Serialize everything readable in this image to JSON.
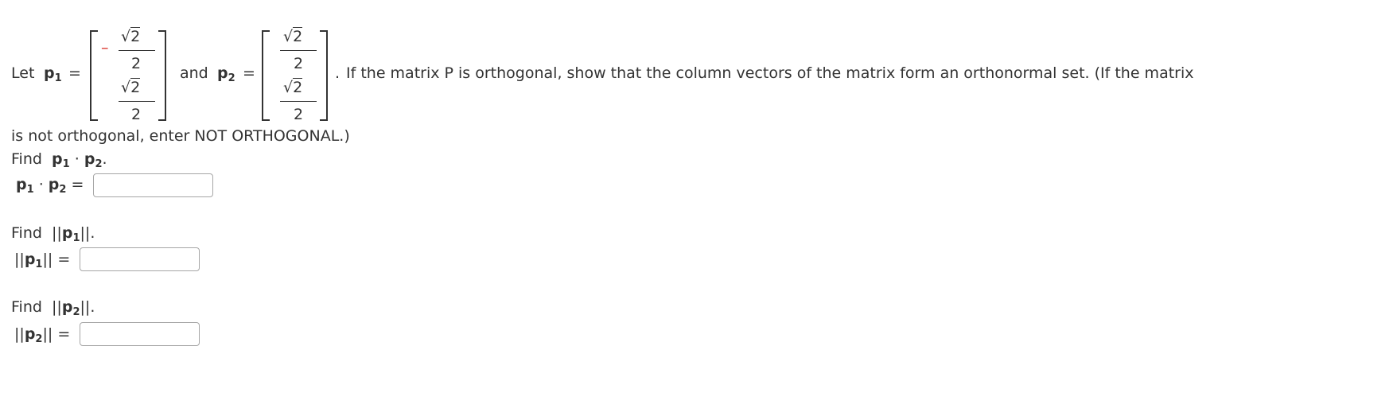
{
  "intro": {
    "let_label": "Let",
    "p1_label": "p",
    "p1_sub": "1",
    "eq": "=",
    "and_label": "and",
    "p2_label": "p",
    "p2_sub": "2",
    "sentence_dot": ".",
    "sentence": "If the matrix P is orthogonal, show that the column vectors of the matrix form an orthonormal set. (If the matrix",
    "sentence_cont": "is not orthogonal, enter NOT ORTHOGONAL.)"
  },
  "p1_vector": {
    "row1_sign": "–",
    "row1_num": "2",
    "row1_den": "2",
    "row2_num": "2",
    "row2_den": "2"
  },
  "p2_vector": {
    "row1_num": "2",
    "row1_den": "2",
    "row2_num": "2",
    "row2_den": "2"
  },
  "q1": {
    "find_label": "Find",
    "expr_a": "p",
    "sub_a": "1",
    "dot": "·",
    "expr_b": "p",
    "sub_b": "2",
    "period": ".",
    "eq": "=",
    "input_value": ""
  },
  "q2": {
    "find_label": "Find",
    "bars_open": "||",
    "expr": "p",
    "sub": "1",
    "bars_close": "||",
    "period": ".",
    "eq": "=",
    "input_value": ""
  },
  "q3": {
    "find_label": "Find",
    "bars_open": "||",
    "expr": "p",
    "sub": "2",
    "bars_close": "||",
    "period": ".",
    "eq": "=",
    "input_value": ""
  },
  "colors": {
    "text": "#333333",
    "negative": "#d9342b",
    "input_border": "#a6a6a6"
  }
}
